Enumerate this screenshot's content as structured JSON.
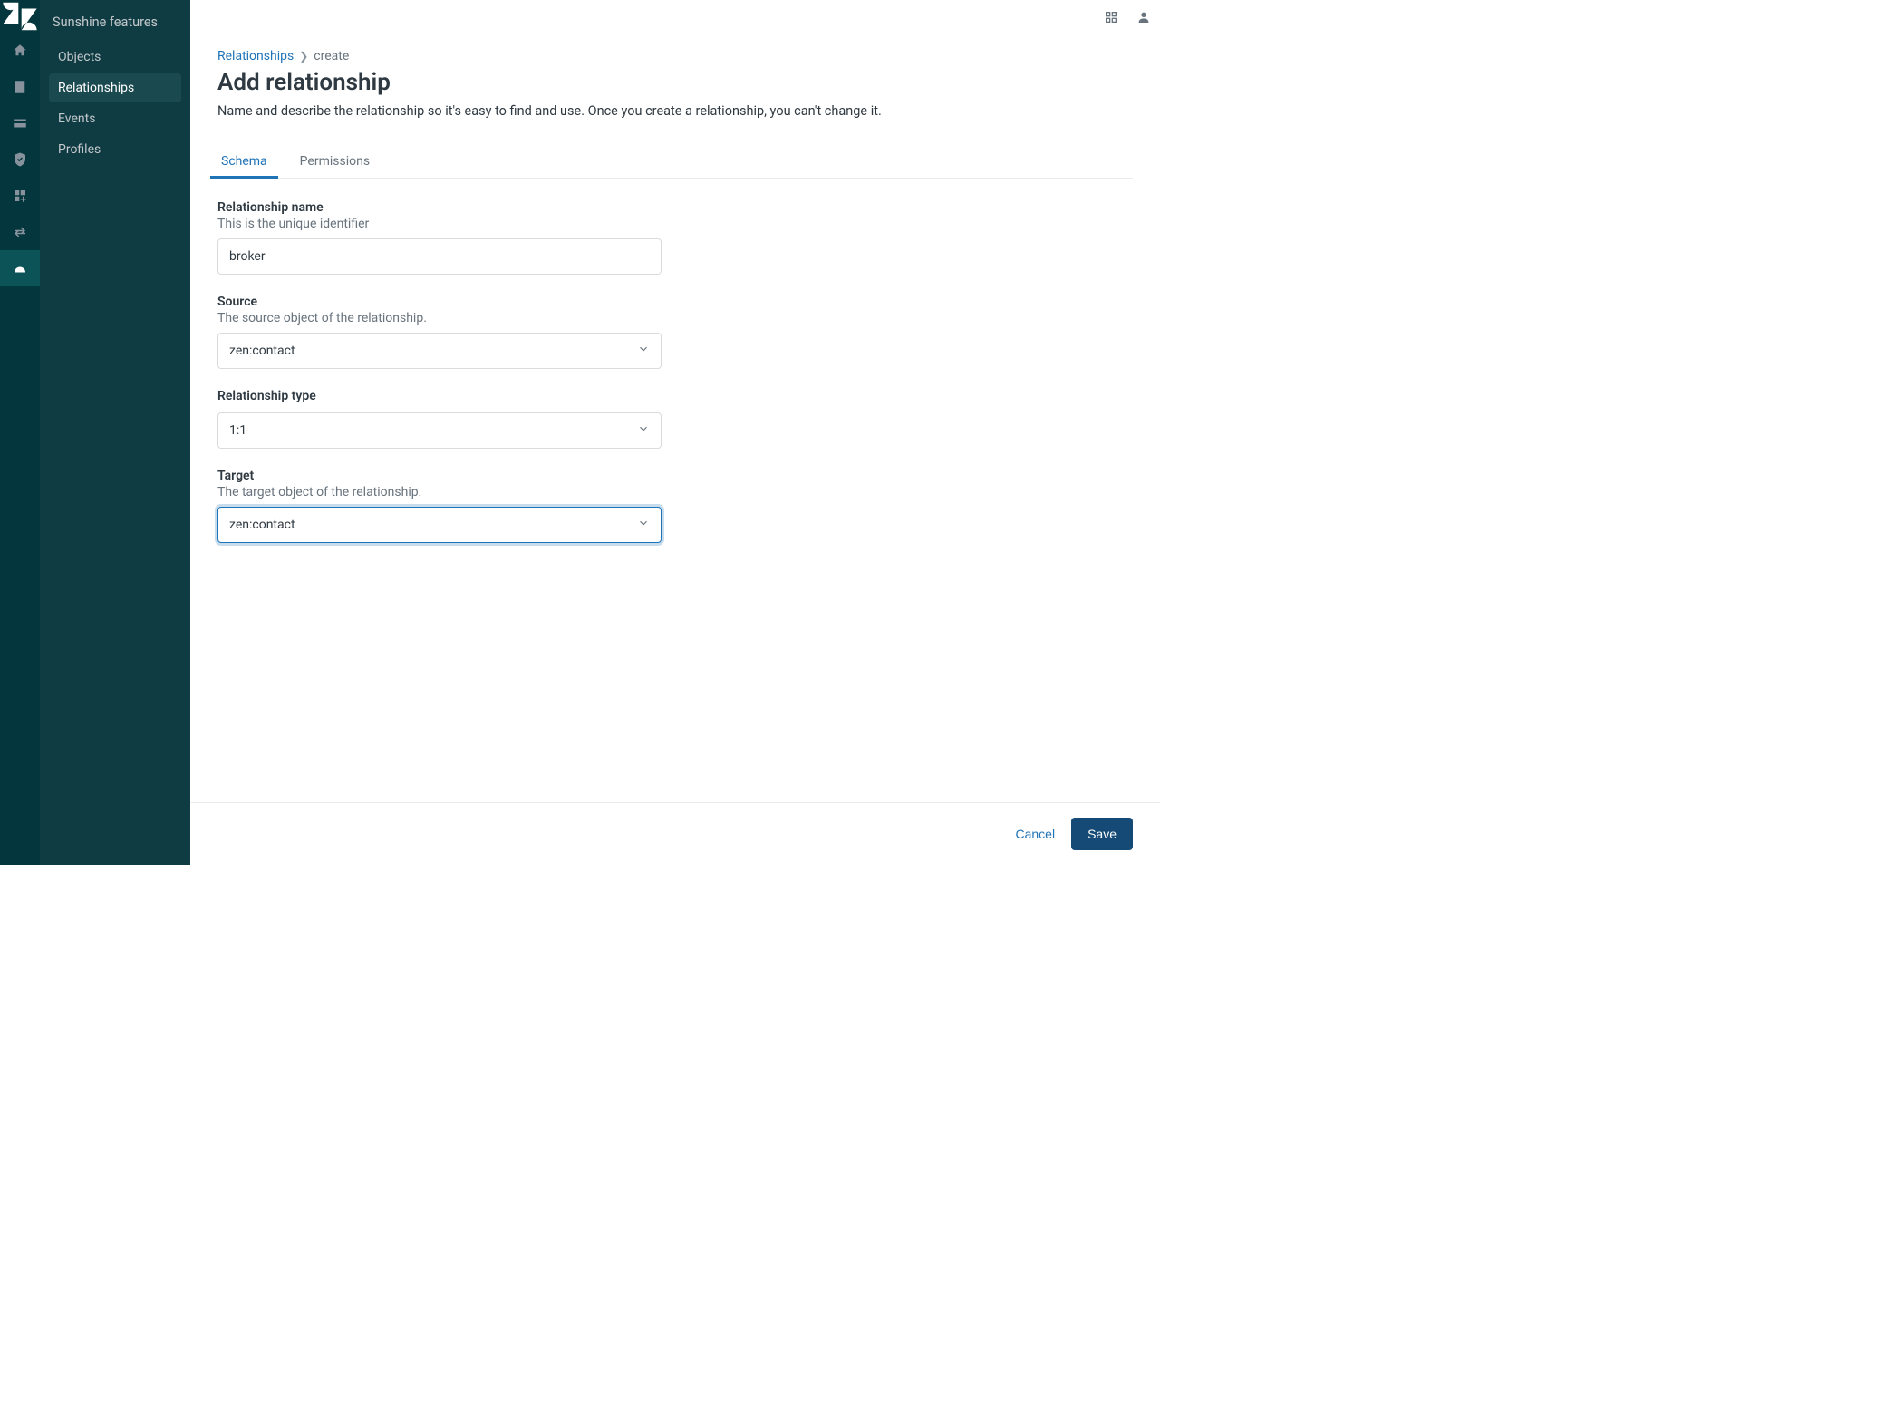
{
  "sidebar": {
    "title": "Sunshine features",
    "items": [
      {
        "label": "Objects"
      },
      {
        "label": "Relationships"
      },
      {
        "label": "Events"
      },
      {
        "label": "Profiles"
      }
    ]
  },
  "breadcrumb": {
    "parent": "Relationships",
    "current": "create"
  },
  "page": {
    "title": "Add relationship",
    "subtitle": "Name and describe the relationship so it's easy to find and use. Once you create a relationship, you can't change it."
  },
  "tabs": {
    "schema": "Schema",
    "permissions": "Permissions"
  },
  "form": {
    "name": {
      "label": "Relationship name",
      "help": "This is the unique identifier",
      "value": "broker"
    },
    "source": {
      "label": "Source",
      "help": "The source object of the relationship.",
      "value": "zen:contact"
    },
    "type": {
      "label": "Relationship type",
      "value": "1:1"
    },
    "target": {
      "label": "Target",
      "help": "The target object of the relationship.",
      "value": "zen:contact"
    }
  },
  "footer": {
    "cancel": "Cancel",
    "save": "Save"
  }
}
